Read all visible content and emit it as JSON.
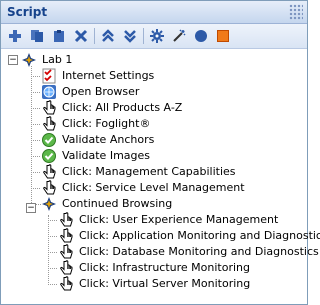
{
  "panel": {
    "title": "Script"
  },
  "toolbar": {
    "buttons": [
      {
        "name": "add-icon",
        "icon": "plus"
      },
      {
        "name": "copy-icon",
        "icon": "copy"
      },
      {
        "name": "paste-icon",
        "icon": "paste"
      },
      {
        "name": "delete-icon",
        "icon": "x"
      },
      {
        "name": "move-up-icon",
        "icon": "chevrons-up"
      },
      {
        "name": "move-down-icon",
        "icon": "chevrons-down"
      },
      {
        "name": "settings-icon",
        "icon": "gear"
      },
      {
        "name": "magic-wand-icon",
        "icon": "wand"
      },
      {
        "name": "record-icon",
        "icon": "circle"
      },
      {
        "name": "stop-icon",
        "icon": "square"
      }
    ]
  },
  "tree": {
    "root": {
      "label": "Lab 1",
      "expanded": true
    },
    "children": [
      {
        "label": "Internet Settings",
        "icon": "checklist-icon"
      },
      {
        "label": "Open Browser",
        "icon": "globe-icon"
      },
      {
        "label": "Click: All Products A-Z",
        "icon": "hand-pointer-icon"
      },
      {
        "label": "Click: Foglight®",
        "icon": "hand-pointer-icon"
      },
      {
        "label": "Validate Anchors",
        "icon": "validate-icon"
      },
      {
        "label": "Validate Images",
        "icon": "validate-icon"
      },
      {
        "label": "Click: Management Capabilities",
        "icon": "hand-pointer-icon"
      },
      {
        "label": "Click: Service Level Management",
        "icon": "hand-pointer-icon"
      },
      {
        "label": "Continued Browsing",
        "icon": "node-icon",
        "group": true,
        "expanded": true
      },
      {
        "label": "Click: User Experience Management",
        "icon": "hand-pointer-icon",
        "nested": true
      },
      {
        "label": "Click: Application Monitoring and Diagnostics",
        "icon": "hand-pointer-icon",
        "nested": true
      },
      {
        "label": "Click: Database Monitoring and Diagnostics",
        "icon": "hand-pointer-icon",
        "nested": true
      },
      {
        "label": "Click: Infrastructure Monitoring",
        "icon": "hand-pointer-icon",
        "nested": true
      },
      {
        "label": "Click: Virtual Server Monitoring",
        "icon": "hand-pointer-icon",
        "nested": true
      }
    ]
  },
  "colors": {
    "title_text": "#15428b",
    "toolbar_icon": "#2d5aa8",
    "stop": "#e05a00"
  }
}
